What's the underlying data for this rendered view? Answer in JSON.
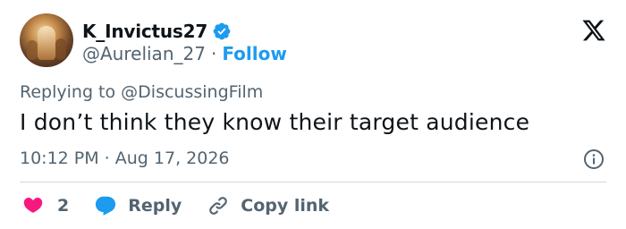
{
  "user": {
    "display_name": "K_Invictus27",
    "handle": "@Aurelian_27",
    "separator": "·",
    "follow_label": "Follow"
  },
  "reply_context": {
    "prefix": "Replying to",
    "mention": "@DiscussingFilm"
  },
  "tweet": {
    "text": "I don’t think they know their target audience",
    "timestamp": "10:12 PM · Aug 17, 2026"
  },
  "actions": {
    "like_count": "2",
    "reply_label": "Reply",
    "copy_link_label": "Copy link"
  },
  "colors": {
    "accent": "#1d9bf0",
    "like": "#f91880",
    "muted_text": "#536471",
    "text": "#0f1419",
    "divider": "#cfd9de"
  },
  "icons": [
    "verified-badge-icon",
    "x-logo-icon",
    "info-icon",
    "heart-icon",
    "reply-bubble-icon",
    "link-icon"
  ]
}
